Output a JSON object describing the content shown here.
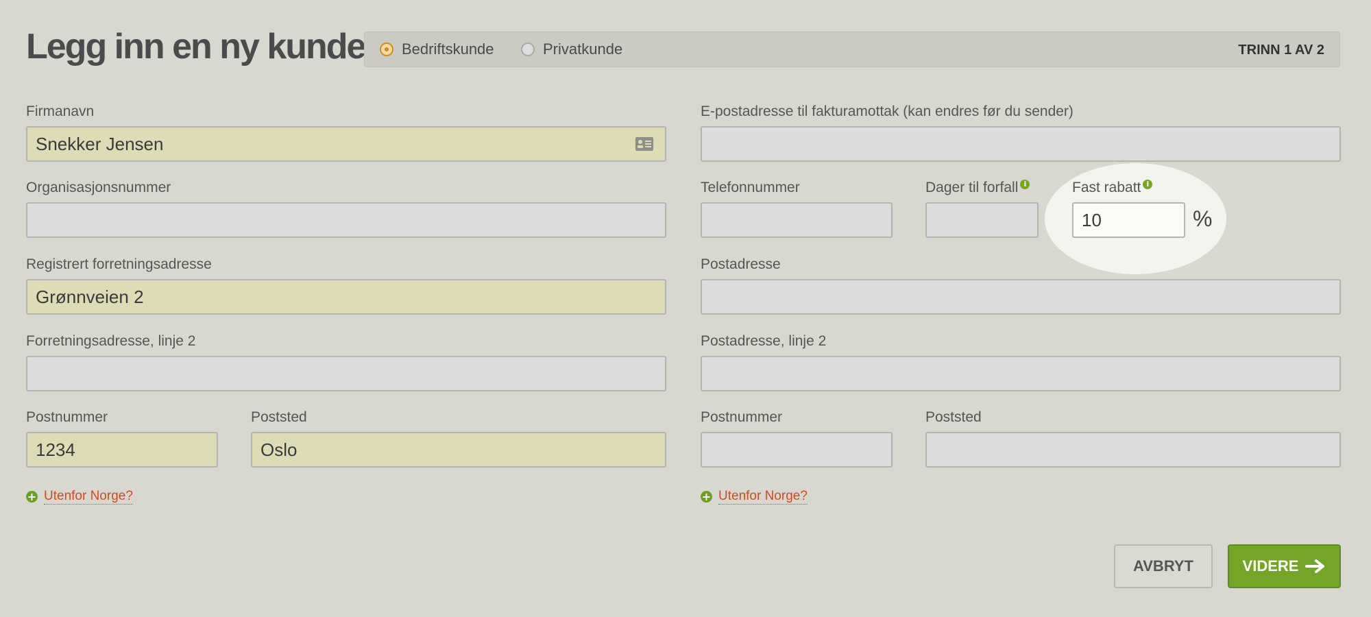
{
  "page_title": "Legg inn en ny kunde",
  "customer_type": {
    "options": [
      {
        "label": "Bedriftskunde",
        "selected": true
      },
      {
        "label": "Privatkunde",
        "selected": false
      }
    ],
    "step": "TRINN 1 AV 2"
  },
  "left": {
    "company_name": {
      "label": "Firmanavn",
      "value": "Snekker Jensen"
    },
    "org_number": {
      "label": "Organisasjonsnummer",
      "value": ""
    },
    "business_address": {
      "label": "Registrert forretningsadresse",
      "value": "Grønnveien 2"
    },
    "business_address_2": {
      "label": "Forretningsadresse, linje 2",
      "value": ""
    },
    "postal_code": {
      "label": "Postnummer",
      "value": "1234"
    },
    "postal_place": {
      "label": "Poststed",
      "value": "Oslo"
    },
    "abroad_link": "Utenfor Norge?"
  },
  "right": {
    "invoice_email": {
      "label": "E-postadresse til fakturamottak (kan endres før du sender)",
      "value": ""
    },
    "phone": {
      "label": "Telefonnummer",
      "value": ""
    },
    "due_days": {
      "label": "Dager til forfall",
      "value": ""
    },
    "fixed_discount": {
      "label": "Fast rabatt",
      "value": "10",
      "unit": "%"
    },
    "postal_address": {
      "label": "Postadresse",
      "value": ""
    },
    "postal_address_2": {
      "label": "Postadresse, linje 2",
      "value": ""
    },
    "postal_code": {
      "label": "Postnummer",
      "value": ""
    },
    "postal_place": {
      "label": "Poststed",
      "value": ""
    },
    "abroad_link": "Utenfor Norge?"
  },
  "buttons": {
    "cancel": "AVBRYT",
    "next": "VIDERE"
  },
  "icons": {
    "contact_card": "contact-card-icon",
    "info": "info-icon",
    "add": "plus-circle-icon",
    "next_arrow": "arrow-right-icon"
  },
  "colors": {
    "accent_green": "#74a526",
    "radio_orange": "#d4881a",
    "link_red": "#d34a1e",
    "filled_field": "#dedcb4"
  }
}
